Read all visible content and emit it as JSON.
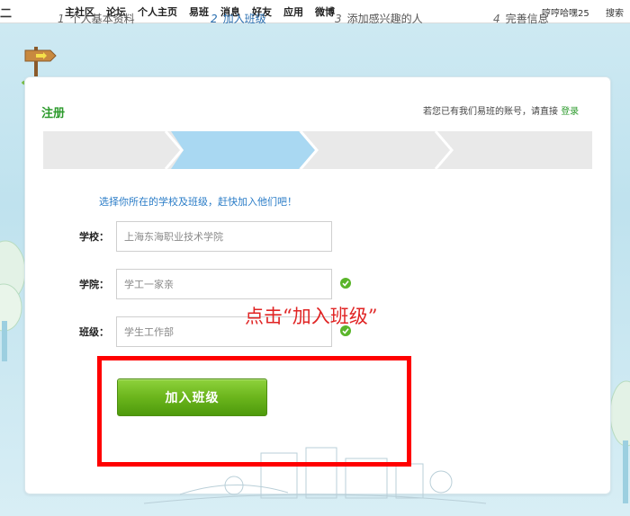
{
  "topbar": {
    "logo_stub": "二",
    "nav": [
      "主社区",
      "论坛",
      "个人主页",
      "易班",
      "消息",
      "好友",
      "应用",
      "微博"
    ],
    "user": "哼哼哈嘿25",
    "search": "搜索"
  },
  "register": {
    "title": "注册",
    "login_hint": "若您已有我们易班的账号，请直接",
    "login_link": "登录"
  },
  "steps": [
    {
      "num": "1",
      "label": "个人基本资料"
    },
    {
      "num": "2",
      "label": "加入班级"
    },
    {
      "num": "3",
      "label": "添加感兴趣的人"
    },
    {
      "num": "4",
      "label": "完善信息"
    }
  ],
  "intro": "选择你所在的学校及班级，赶快加入他们吧！",
  "fields": {
    "school": {
      "label": "学校：",
      "value": "上海东海职业技术学院"
    },
    "college": {
      "label": "学院：",
      "value": "学工一家亲"
    },
    "class": {
      "label": "班级：",
      "value": "学生工作部"
    }
  },
  "annotation": "点击“加入班级”",
  "join_button": "加入班级",
  "colors": {
    "accent_green": "#2c9a2c",
    "step_active": "#a9d8f2",
    "annotation_red": "#e02424",
    "check_green": "#5ab52a"
  }
}
